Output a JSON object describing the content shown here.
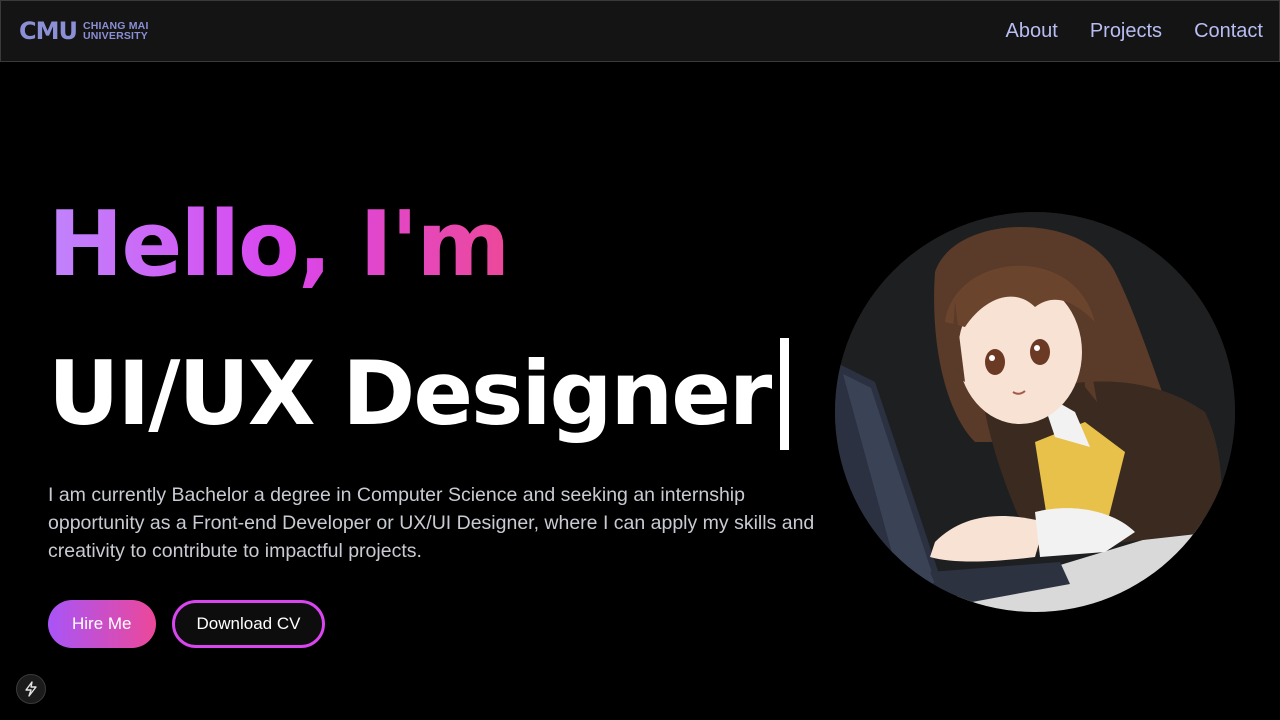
{
  "header": {
    "logo_mark": "CMU",
    "logo_line1": "CHIANG MAI",
    "logo_line2": "UNIVERSITY",
    "nav": [
      {
        "label": "About"
      },
      {
        "label": "Projects"
      },
      {
        "label": "Contact"
      }
    ]
  },
  "hero": {
    "greeting": "Hello, I'm",
    "role": "UI/UX Designer",
    "description": "I am currently Bachelor a degree in Computer Science and seeking an internship opportunity as a Front-end Developer or UX/UI Designer, where I can apply my skills and creativity to contribute to impactful projects.",
    "hire_label": "Hire Me",
    "cv_label": "Download CV"
  },
  "icons": {
    "avatar": "anime-girl-laptop-illustration",
    "floating_button": "lightning-bolt-icon"
  },
  "colors": {
    "accent_start": "#c084fc",
    "accent_end": "#ec4899",
    "nav_link": "#b8bdf2",
    "background": "#000000"
  }
}
